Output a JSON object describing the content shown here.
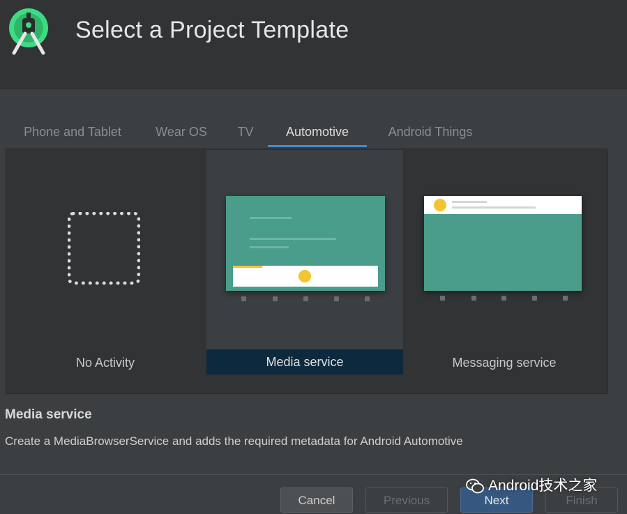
{
  "header": {
    "title": "Select a Project Template",
    "logo_icon": "android-studio-logo-icon"
  },
  "tabs": [
    {
      "label": "Phone and Tablet"
    },
    {
      "label": "Wear OS"
    },
    {
      "label": "TV"
    },
    {
      "label": "Automotive",
      "active": true
    },
    {
      "label": "Android Things"
    }
  ],
  "templates": [
    {
      "label": "No Activity"
    },
    {
      "label": "Media service",
      "selected": true
    },
    {
      "label": "Messaging service"
    }
  ],
  "description": {
    "title": "Media service",
    "text": "Create a MediaBrowserService and adds the required metadata for Android Automotive"
  },
  "buttons": {
    "cancel": "Cancel",
    "previous": "Previous",
    "next": "Next",
    "finish": "Finish"
  },
  "watermark": {
    "text": "Android技术之家",
    "icon": "wechat-icon"
  },
  "colors": {
    "accent": "#4a88c7",
    "teal": "#4a9d8a",
    "yellow": "#f4c430",
    "selected_bg": "#0d293e"
  }
}
